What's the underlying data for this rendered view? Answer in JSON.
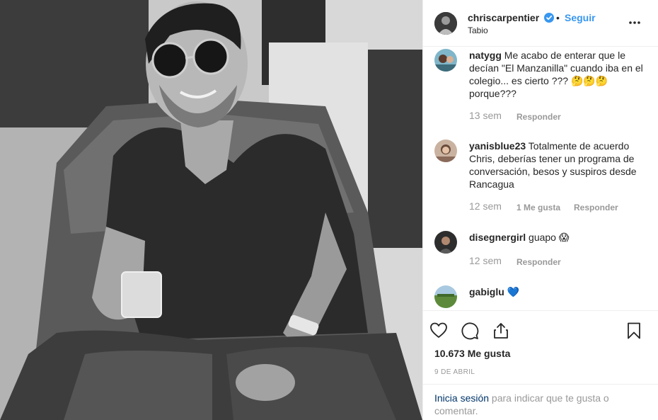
{
  "post": {
    "username": "chriscarpentier",
    "dot": "•",
    "follow_label": "Seguir",
    "location": "Tabio",
    "more_icon": "more-options-icon"
  },
  "comments": [
    {
      "username": "natygg",
      "text": "Me acabo de enterar que le decían \"El Manzanilla\" cuando iba en el colegio... es cierto ??? 🤔🤔🤔 porque???",
      "time": "13 sem",
      "likes": "",
      "reply": "Responder"
    },
    {
      "username": "yanisblue23",
      "text": "Totalmente de acuerdo Chris, deberías tener un programa de conversación, besos y suspiros desde Rancagua",
      "time": "12 sem",
      "likes": "1 Me gusta",
      "reply": "Responder"
    },
    {
      "username": "disegnergirl",
      "text": "guapo 😱",
      "time": "12 sem",
      "likes": "",
      "reply": "Responder"
    },
    {
      "username": "gabiglu",
      "text": "💙",
      "time": "",
      "likes": "",
      "reply": ""
    }
  ],
  "actions": {
    "like_icon": "heart-icon",
    "comment_icon": "comment-icon",
    "share_icon": "share-icon",
    "save_icon": "bookmark-icon",
    "likes_count": "10.673 Me gusta",
    "date": "9 DE ABRIL"
  },
  "login": {
    "link": "Inicia sesión",
    "rest": " para indicar que te gusta o comentar."
  },
  "colors": {
    "link_blue": "#3897f0",
    "verified_blue": "#3897f0",
    "muted": "#999999",
    "text": "#262626"
  }
}
